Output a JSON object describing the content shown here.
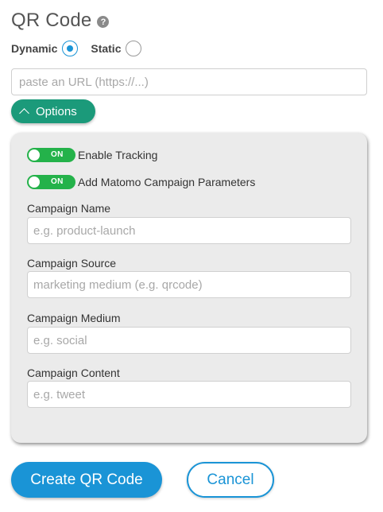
{
  "header": {
    "title": "QR Code",
    "help_icon": "question-circle-icon",
    "help_glyph": "?"
  },
  "mode": {
    "dynamic_label": "Dynamic",
    "static_label": "Static",
    "selected": "Dynamic"
  },
  "url": {
    "placeholder": "paste an URL (https://...)",
    "value": ""
  },
  "options": {
    "label": "Options",
    "expanded": true
  },
  "panel": {
    "toggles": [
      {
        "state": "ON",
        "label": "Enable Tracking",
        "on": true
      },
      {
        "state": "ON",
        "label": "Add Matomo Campaign Parameters",
        "on": true
      }
    ],
    "fields": [
      {
        "label": "Campaign Name",
        "placeholder": "e.g. product-launch",
        "value": ""
      },
      {
        "label": "Campaign Source",
        "placeholder": "marketing medium (e.g. qrcode)",
        "value": ""
      },
      {
        "label": "Campaign Medium",
        "placeholder": "e.g. social",
        "value": ""
      },
      {
        "label": "Campaign Content",
        "placeholder": "e.g. tweet",
        "value": ""
      }
    ]
  },
  "actions": {
    "create_label": "Create QR Code",
    "cancel_label": "Cancel"
  },
  "colors": {
    "primary": "#1a94d6",
    "options_green": "#1b9a7a",
    "toggle_green": "#24b24a",
    "panel_bg": "#ebebeb"
  }
}
